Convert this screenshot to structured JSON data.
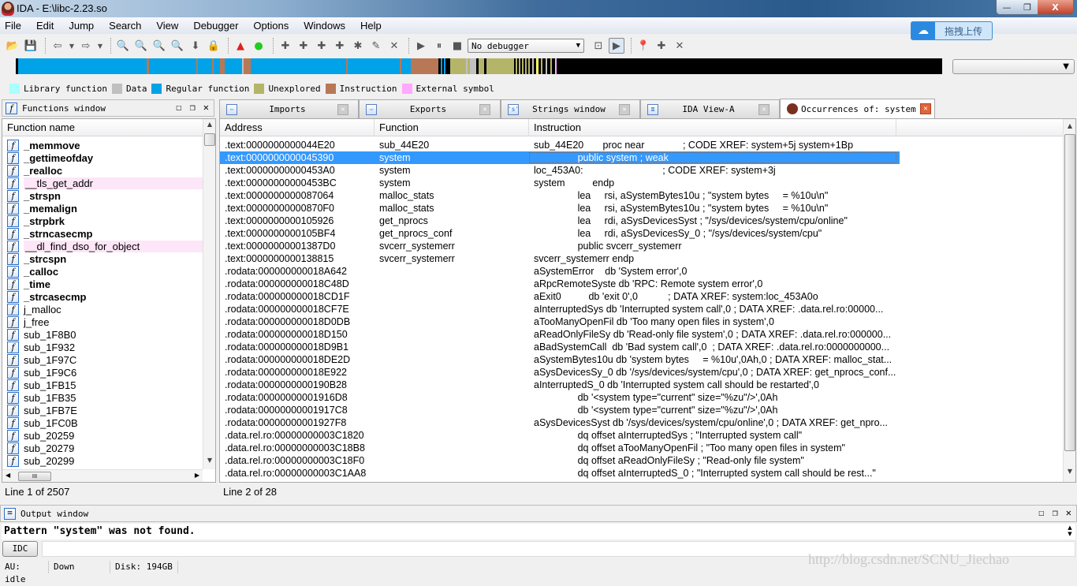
{
  "window": {
    "title": "IDA - E:\\libc-2.23.so",
    "minimize": "—",
    "restore": "❐",
    "close": "X"
  },
  "menu": [
    "File",
    "Edit",
    "Jump",
    "Search",
    "View",
    "Debugger",
    "Options",
    "Windows",
    "Help"
  ],
  "upload_widget": {
    "label": "拖拽上传"
  },
  "toolbar": {
    "debugger_select": "No debugger",
    "icons": [
      "open-file",
      "save",
      "back",
      "back-dropdown",
      "forward",
      "forward-dropdown",
      "search-binary-seq",
      "search-text",
      "search-immediate",
      "search-next",
      "jump-down",
      "lock-code",
      "rename-warning",
      "green-run",
      "make-code",
      "make-data",
      "make-ascii",
      "make-struct",
      "make-struct-dropdown",
      "make-offset",
      "edit-patch",
      "undefine",
      "start-process",
      "pause-process",
      "stop-process",
      "attach",
      "run-to-cursor",
      "breakpoint-list",
      "add-breakpoint",
      "delete-breakpoint"
    ]
  },
  "navigation": {
    "colors": {
      "library": "#aaffff",
      "data": "#c0c0c0",
      "regular": "#00a2e8",
      "unexplored": "#b5b56a",
      "instruction": "#b87856",
      "external": "#ffa9ff",
      "black": "#000000"
    }
  },
  "legend": [
    {
      "label": "Library function",
      "color": "#aaffff"
    },
    {
      "label": "Data",
      "color": "#c0c0c0"
    },
    {
      "label": "Regular function",
      "color": "#00a2e8"
    },
    {
      "label": "Unexplored",
      "color": "#b5b56a"
    },
    {
      "label": "Instruction",
      "color": "#b87856"
    },
    {
      "label": "External symbol",
      "color": "#ffa9ff"
    }
  ],
  "functions_window": {
    "title": "Functions window",
    "column": "Function name",
    "items": [
      {
        "name": "_memmove",
        "style": "bold"
      },
      {
        "name": "_gettimeofday",
        "style": "bold"
      },
      {
        "name": "_realloc",
        "style": "bold"
      },
      {
        "name": "__tls_get_addr",
        "style": "ext"
      },
      {
        "name": "_strspn",
        "style": "bold"
      },
      {
        "name": "_memalign",
        "style": "bold"
      },
      {
        "name": "_strpbrk",
        "style": "bold"
      },
      {
        "name": "_strncasecmp",
        "style": "bold"
      },
      {
        "name": "__dl_find_dso_for_object",
        "style": "ext"
      },
      {
        "name": "_strcspn",
        "style": "bold"
      },
      {
        "name": "_calloc",
        "style": "bold"
      },
      {
        "name": "_time",
        "style": "bold"
      },
      {
        "name": "_strcasecmp",
        "style": "bold"
      },
      {
        "name": "j_malloc",
        "style": "normal"
      },
      {
        "name": "j_free",
        "style": "normal"
      },
      {
        "name": "sub_1F8B0",
        "style": "normal"
      },
      {
        "name": "sub_1F932",
        "style": "normal"
      },
      {
        "name": "sub_1F97C",
        "style": "normal"
      },
      {
        "name": "sub_1F9C6",
        "style": "normal"
      },
      {
        "name": "sub_1FB15",
        "style": "normal"
      },
      {
        "name": "sub_1FB35",
        "style": "normal"
      },
      {
        "name": "sub_1FB7E",
        "style": "normal"
      },
      {
        "name": "sub_1FC0B",
        "style": "normal"
      },
      {
        "name": "sub_20259",
        "style": "normal"
      },
      {
        "name": "sub_20279",
        "style": "normal"
      },
      {
        "name": "sub_20299",
        "style": "normal"
      }
    ],
    "status": "Line 1 of 2507"
  },
  "tabs": [
    {
      "label": "Imports",
      "icon": "imports-icon",
      "active": false
    },
    {
      "label": "Exports",
      "icon": "exports-icon",
      "active": false
    },
    {
      "label": "Strings window",
      "icon": "strings-icon",
      "active": false
    },
    {
      "label": "IDA View-A",
      "icon": "ida-view-icon",
      "active": false
    },
    {
      "label": "Occurrences of: system",
      "icon": "ida-avatar-icon",
      "active": true
    }
  ],
  "occurrences": {
    "columns": [
      "Address",
      "Function",
      "Instruction"
    ],
    "rows": [
      {
        "address": ".text:0000000000044E20",
        "function": "sub_44E20",
        "instruction": "sub_44E20       proc near              ; CODE XREF: system+5j system+1Bp"
      },
      {
        "address": ".text:0000000000045390",
        "function": "system",
        "instruction": "                public system ; weak",
        "selected": true
      },
      {
        "address": ".text:00000000000453A0",
        "function": "system",
        "instruction": "loc_453A0:                             ; CODE XREF: system+3j"
      },
      {
        "address": ".text:00000000000453BC",
        "function": "system",
        "instruction": "system          endp"
      },
      {
        "address": ".text:0000000000087064",
        "function": "malloc_stats",
        "instruction": "                lea     rsi, aSystemBytes10u ; \"system bytes     = %10u\\n\""
      },
      {
        "address": ".text:00000000000870F0",
        "function": "malloc_stats",
        "instruction": "                lea     rsi, aSystemBytes10u ; \"system bytes     = %10u\\n\""
      },
      {
        "address": ".text:0000000000105926",
        "function": "get_nprocs",
        "instruction": "                lea     rdi, aSysDevicesSyst ; \"/sys/devices/system/cpu/online\""
      },
      {
        "address": ".text:0000000000105BF4",
        "function": "get_nprocs_conf",
        "instruction": "                lea     rdi, aSysDevicesSy_0 ; \"/sys/devices/system/cpu\""
      },
      {
        "address": ".text:00000000001387D0",
        "function": "svcerr_systemerr",
        "instruction": "                public svcerr_systemerr"
      },
      {
        "address": ".text:0000000000138815",
        "function": "svcerr_systemerr",
        "instruction": "svcerr_systemerr endp"
      },
      {
        "address": ".rodata:000000000018A642",
        "function": "",
        "instruction": "aSystemError    db 'System error',0"
      },
      {
        "address": ".rodata:000000000018C48D",
        "function": "",
        "instruction": "aRpcRemoteSyste db 'RPC: Remote system error',0"
      },
      {
        "address": ".rodata:000000000018CD1F",
        "function": "",
        "instruction": "aExit0          db 'exit 0',0           ; DATA XREF: system:loc_453A0o"
      },
      {
        "address": ".rodata:000000000018CF7E",
        "function": "",
        "instruction": "aInterruptedSys db 'Interrupted system call',0 ; DATA XREF: .data.rel.ro:00000..."
      },
      {
        "address": ".rodata:000000000018D0DB",
        "function": "",
        "instruction": "aTooManyOpenFil db 'Too many open files in system',0"
      },
      {
        "address": ".rodata:000000000018D150",
        "function": "",
        "instruction": "aReadOnlyFileSy db 'Read-only file system',0 ; DATA XREF: .data.rel.ro:000000..."
      },
      {
        "address": ".rodata:000000000018D9B1",
        "function": "",
        "instruction": "aBadSystemCall  db 'Bad system call',0  ; DATA XREF: .data.rel.ro:0000000000..."
      },
      {
        "address": ".rodata:000000000018DE2D",
        "function": "",
        "instruction": "aSystemBytes10u db 'system bytes     = %10u',0Ah,0 ; DATA XREF: malloc_stat..."
      },
      {
        "address": ".rodata:000000000018E922",
        "function": "",
        "instruction": "aSysDevicesSy_0 db '/sys/devices/system/cpu',0 ; DATA XREF: get_nprocs_conf..."
      },
      {
        "address": ".rodata:0000000000190B28",
        "function": "",
        "instruction": "aInterruptedS_0 db 'Interrupted system call should be restarted',0"
      },
      {
        "address": ".rodata:00000000001916D8",
        "function": "",
        "instruction": "                db '<system type=\"current\" size=\"%zu\"/>',0Ah"
      },
      {
        "address": ".rodata:00000000001917C8",
        "function": "",
        "instruction": "                db '<system type=\"current\" size=\"%zu\"/>',0Ah"
      },
      {
        "address": ".rodata:00000000001927F8",
        "function": "",
        "instruction": "aSysDevicesSyst db '/sys/devices/system/cpu/online',0 ; DATA XREF: get_npro..."
      },
      {
        "address": ".data.rel.ro:00000000003C1820",
        "function": "",
        "instruction": "                dq offset aInterruptedSys ; \"Interrupted system call\""
      },
      {
        "address": ".data.rel.ro:00000000003C18B8",
        "function": "",
        "instruction": "                dq offset aTooManyOpenFil ; \"Too many open files in system\""
      },
      {
        "address": ".data.rel.ro:00000000003C18F0",
        "function": "",
        "instruction": "                dq offset aReadOnlyFileSy ; \"Read-only file system\""
      },
      {
        "address": ".data.rel.ro:00000000003C1AA8",
        "function": "",
        "instruction": "                dq offset aInterruptedS_0 ; \"Interrupted system call should be rest...\""
      }
    ],
    "status": "Line 2 of 28"
  },
  "output_window": {
    "title": "Output window",
    "text": "Pattern \"system\" was not found.",
    "idc_button": "IDC",
    "idc_input": ""
  },
  "statusbar": {
    "au": "AU:  idle",
    "direction": "Down",
    "disk": "Disk: 194GB"
  },
  "watermark": "http://blog.csdn.net/SCNU_Jiechao"
}
